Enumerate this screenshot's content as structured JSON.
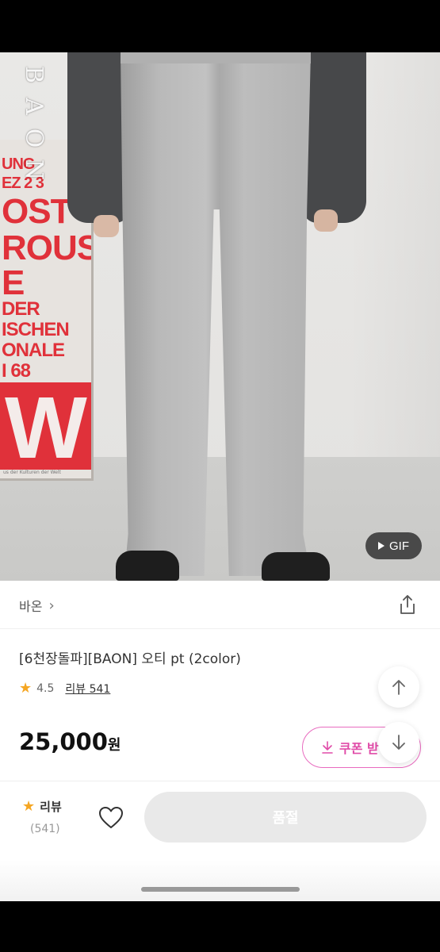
{
  "hero": {
    "logo_letters": [
      "B",
      "A",
      "O",
      "N"
    ],
    "poster_lines": [
      "UNG",
      "EZ 2 3",
      "OST",
      "ROUS",
      "E",
      "DER",
      "ISCHEN",
      "ONALE",
      "I 68"
    ],
    "poster_big_letter": "W",
    "poster_footnote": "us der Kulturen der Welt",
    "gif_badge": "GIF"
  },
  "product": {
    "brand": "바온",
    "title": "[6천장돌파][BAON] 오티 pt (2color)",
    "rating": "4.5",
    "review_link": "리뷰 541",
    "price": "25,000",
    "price_unit": "원",
    "coupon_label": "쿠폰 받"
  },
  "bottom_bar": {
    "review_label": "리뷰",
    "review_count": "(541)",
    "buy_button_label": "품절"
  },
  "icons": {
    "share": "share-icon",
    "chevron": "chevron-right-icon",
    "star": "star-icon",
    "scroll_up": "arrow-up-icon",
    "scroll_down": "arrow-down-icon",
    "download": "download-icon",
    "heart": "heart-icon",
    "play": "play-icon"
  },
  "colors": {
    "accent_pink": "#e04ba8",
    "star": "#f5a623",
    "soldout_bg": "#e9e9e9"
  }
}
